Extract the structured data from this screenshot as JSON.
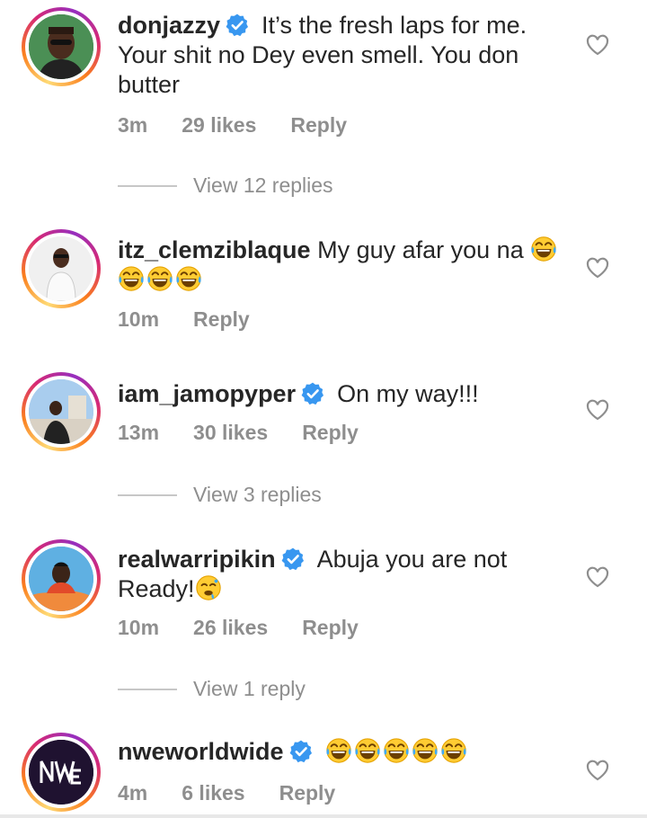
{
  "comments": [
    {
      "username": "donjazzy",
      "verified": true,
      "text": "It’s the fresh laps for me. Your shit no Dey even smell. You don butter",
      "time": "3m",
      "likes": "29 likes",
      "reply": "Reply",
      "view_replies": "View 12 replies"
    },
    {
      "username": "itz_clemziblaque",
      "verified": false,
      "text": "My guy afar you na",
      "emojis": [
        "face-with-tears-of-joy",
        "face-with-tears-of-joy",
        "face-with-tears-of-joy",
        "face-with-tears-of-joy"
      ],
      "time": "10m",
      "reply": "Reply"
    },
    {
      "username": "iam_jamopyper",
      "verified": true,
      "text": "On my way!!!",
      "time": "13m",
      "likes": "30 likes",
      "reply": "Reply",
      "view_replies": "View 3 replies"
    },
    {
      "username": "realwarripikin",
      "verified": true,
      "text": "Abuja you are not Ready!",
      "emojis": [
        "drooling-face"
      ],
      "time": "10m",
      "likes": "26 likes",
      "reply": "Reply",
      "view_replies": "View 1 reply"
    },
    {
      "username": "nweworldwide",
      "verified": true,
      "text": "",
      "emojis": [
        "face-with-tears-of-joy",
        "face-with-tears-of-joy",
        "face-with-tears-of-joy",
        "face-with-tears-of-joy",
        "face-with-tears-of-joy"
      ],
      "time": "4m",
      "likes": "6 likes",
      "reply": "Reply"
    }
  ],
  "colors": {
    "text": "#262626",
    "meta": "#8e8e8e",
    "verified": "#3897f0",
    "ring_start": "#feda75",
    "ring_mid": "#d62976",
    "ring_end": "#962fbf"
  },
  "icons": {
    "like": "heart-outline-icon",
    "verified": "verified-badge-icon"
  }
}
